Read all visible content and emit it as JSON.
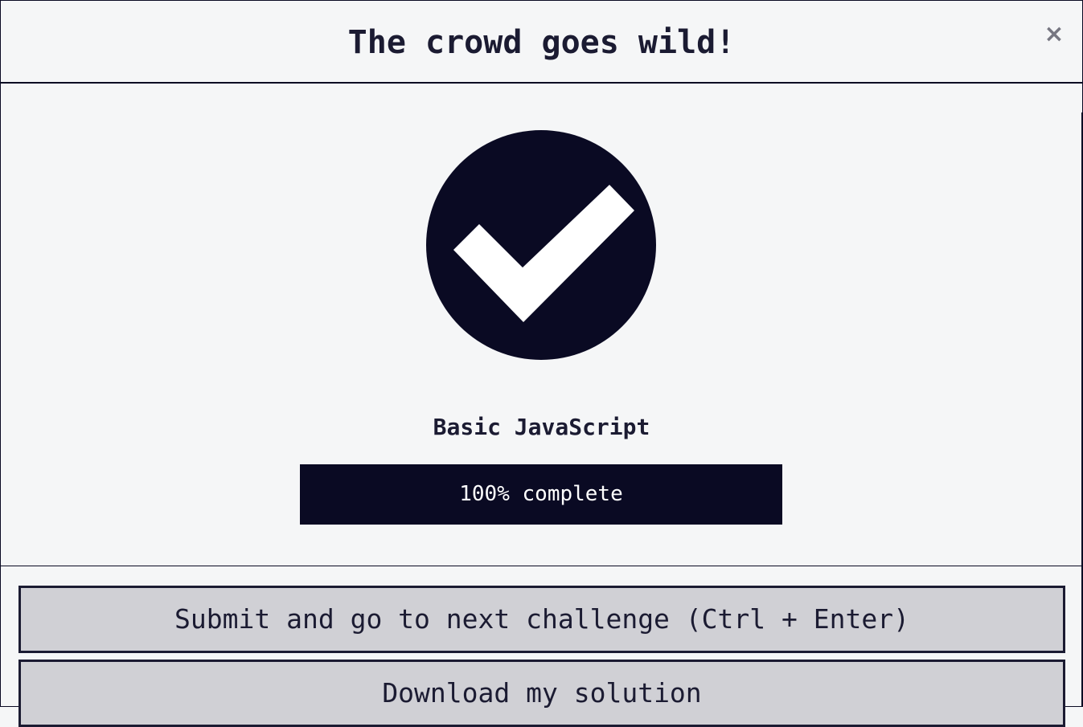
{
  "modal": {
    "title": "The crowd goes wild!",
    "close_label": "×"
  },
  "completion": {
    "icon": "check-circle-icon",
    "certification_title": "Basic JavaScript",
    "progress_label": "100% complete",
    "progress_percent": 100
  },
  "actions": {
    "submit_label": "Submit and go to next challenge (Ctrl + Enter)",
    "download_label": "Download my solution"
  },
  "colors": {
    "primary": "#0a0a23",
    "background": "#f5f6f7",
    "button_bg": "#d0d0d5",
    "text": "#1b1b32"
  }
}
